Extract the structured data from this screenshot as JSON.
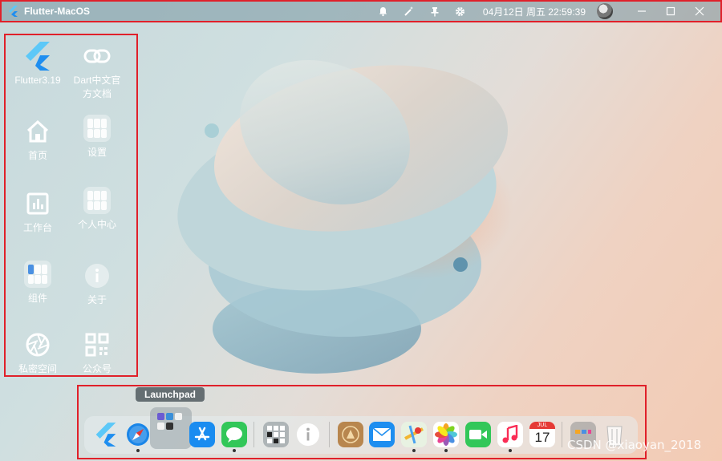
{
  "window": {
    "title": "Flutter-MacOS",
    "datetime": "04月12日 周五 22:59:39"
  },
  "titlebar_icons": [
    "bell-icon",
    "magic-wand-icon",
    "pin-icon",
    "gear-icon"
  ],
  "window_controls": [
    "minimize-icon",
    "maximize-icon",
    "close-icon"
  ],
  "sidebar": {
    "items": [
      {
        "label": "Flutter3.19",
        "icon": "flutter-logo-icon"
      },
      {
        "label": "Dart中文官方文档",
        "icon": "link-icon"
      },
      {
        "label": "首页",
        "icon": "home-icon"
      },
      {
        "label": "设置",
        "icon": "settings-tile-icon"
      },
      {
        "label": "工作台",
        "icon": "chart-icon"
      },
      {
        "label": "个人中心",
        "icon": "profile-tile-icon"
      },
      {
        "label": "组件",
        "icon": "components-tile-icon"
      },
      {
        "label": "关于",
        "icon": "info-icon"
      },
      {
        "label": "私密空间",
        "icon": "aperture-icon"
      },
      {
        "label": "公众号",
        "icon": "qrcode-icon"
      }
    ]
  },
  "dock": {
    "tooltip": "Launchpad",
    "items": [
      "flutter",
      "safari",
      "launchpad",
      "app-store",
      "messages",
      "widgets",
      "info",
      "gallery",
      "mail",
      "maps",
      "photos",
      "facetime",
      "music",
      "calendar",
      "folder",
      "trash"
    ],
    "calendar": {
      "month": "JUL",
      "day": "17"
    }
  },
  "watermark": "CSDN @xiaoyan_2018",
  "colors": {
    "frame": "#e0202a",
    "flutter_blue": "#2aa5e8",
    "accent_blue": "#1e8ef0"
  }
}
